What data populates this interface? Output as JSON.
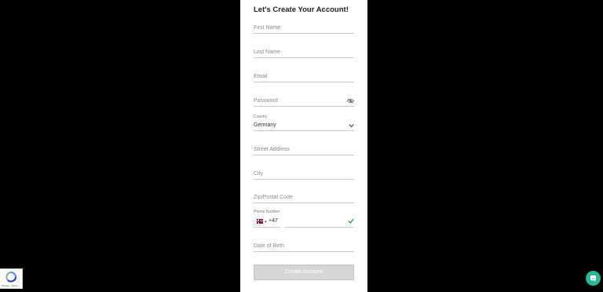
{
  "form": {
    "title": "Let's Create Your Account!",
    "first_name_placeholder": "First Name",
    "last_name_placeholder": "Last Name",
    "email_placeholder": "Email",
    "password_placeholder": "Password",
    "country_label": "Country",
    "country_value": "Germany",
    "street_placeholder": "Street Address",
    "city_placeholder": "City",
    "zip_placeholder": "Zip/Postal Code",
    "phone_label": "Phone Number",
    "phone_code": "+47",
    "dob_placeholder": "Date of Birth",
    "submit_label": "Create Account"
  },
  "recaptcha": {
    "footer": "Privacy - Terms"
  },
  "icons": {
    "password_toggle": "eye-off-icon",
    "country_dropdown": "chevron-down-icon",
    "phone_valid": "check-icon",
    "country_flag": "norway-flag-icon",
    "chat": "chat-icon"
  },
  "colors": {
    "background": "#000000",
    "panel": "#ffffff",
    "valid": "#3aa655",
    "chat": "#2bb596",
    "button_disabled": "#d6d6d6"
  }
}
